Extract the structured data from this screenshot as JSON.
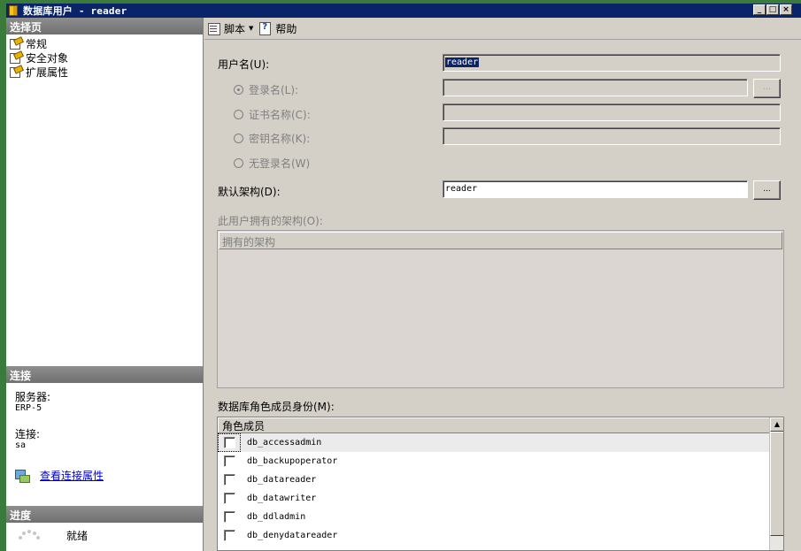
{
  "window": {
    "title": "数据库用户 - reader",
    "controls": {
      "minimize": "_",
      "maximize": "□",
      "close": "×"
    }
  },
  "left": {
    "select_page_header": "选择页",
    "pages": [
      {
        "label": "常规",
        "icon": "page-wrench-icon"
      },
      {
        "label": "安全对象",
        "icon": "page-wrench-icon"
      },
      {
        "label": "扩展属性",
        "icon": "page-wrench-icon"
      }
    ],
    "connection_header": "连接",
    "server_label": "服务器:",
    "server_value": "ERP-5",
    "connection_label": "连接:",
    "connection_value": "sa",
    "view_conn_props": "查看连接属性",
    "progress_header": "进度",
    "progress_status": "就绪"
  },
  "toolbar": {
    "script_label": "脚本",
    "help_label": "帮助"
  },
  "form": {
    "username_label": "用户名(U):",
    "username_value": "reader",
    "login_name_label": "登录名(L):",
    "cert_name_label": "证书名称(C):",
    "key_name_label": "密钥名称(K):",
    "no_login_label": "无登录名(W)",
    "default_schema_label": "默认架构(D):",
    "default_schema_value": "reader",
    "browse_label": "...",
    "owned_schemas_label": "此用户拥有的架构(O):",
    "owned_schemas_header": "拥有的架构",
    "role_membership_label": "数据库角色成员身份(M):",
    "role_header": "角色成员",
    "roles": [
      "db_accessadmin",
      "db_backupoperator",
      "db_datareader",
      "db_datawriter",
      "db_ddladmin",
      "db_denydatareader"
    ]
  }
}
